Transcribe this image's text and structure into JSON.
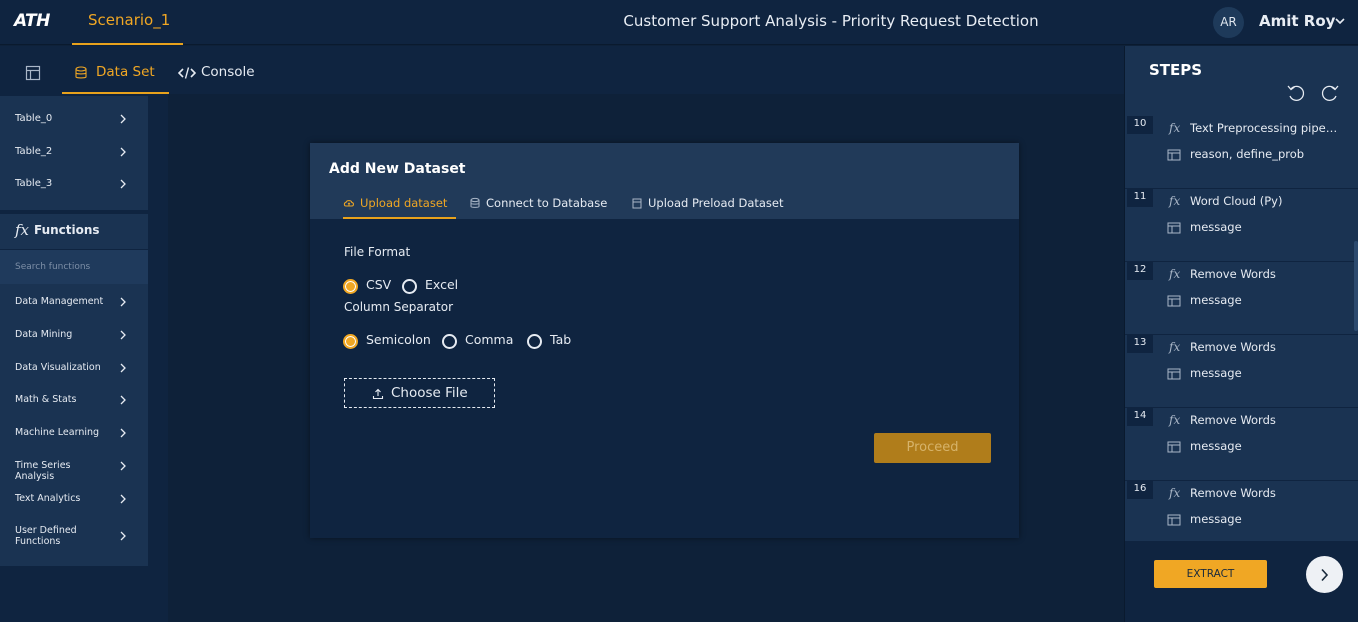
{
  "app": {
    "logo": "ATH",
    "scenario_tab": "Scenario_1",
    "page_title": "Customer Support Analysis - Priority Request Detection",
    "user_initials": "AR",
    "user_name": "Amit Roy"
  },
  "subtabs": {
    "dataset": "Data Set",
    "console": "Console"
  },
  "sidebar": {
    "tables": [
      "Table_0",
      "Table_2",
      "Table_3"
    ],
    "functions_title": "Functions",
    "functions_icon": "fx",
    "search_placeholder": "Search functions",
    "categories": [
      "Data Management",
      "Data Mining",
      "Data Visualization",
      "Math & Stats",
      "Machine Learning",
      "Time Series Analysis",
      "Text Analytics",
      "User Defined Functions"
    ]
  },
  "dialog": {
    "title": "Add New Dataset",
    "tabs": [
      "Upload dataset",
      "Connect to Database",
      "Upload Preload Dataset"
    ],
    "file_format_label": "File Format",
    "file_formats": [
      "CSV",
      "Excel"
    ],
    "file_format_selected": "CSV",
    "separator_label": "Column Separator",
    "separators": [
      "Semicolon",
      "Comma",
      "Tab"
    ],
    "separator_selected": "Semicolon",
    "choose_file": "Choose File",
    "proceed": "Proceed"
  },
  "steps": {
    "title": "STEPS",
    "items": [
      {
        "num": "10",
        "fx": "fx",
        "name": "Text Preprocessing pipeline",
        "column": "reason, define_prob"
      },
      {
        "num": "11",
        "fx": "fx",
        "name": "Word Cloud (Py)",
        "column": "message"
      },
      {
        "num": "12",
        "fx": "fx",
        "name": "Remove Words",
        "column": "message"
      },
      {
        "num": "13",
        "fx": "fx",
        "name": "Remove Words",
        "column": "message"
      },
      {
        "num": "14",
        "fx": "fx",
        "name": "Remove Words",
        "column": "message"
      },
      {
        "num": "16",
        "fx": "fx",
        "name": "Remove Words",
        "column": "message"
      }
    ],
    "extract": "EXTRACT"
  },
  "colors": {
    "accent": "#f0a724",
    "background": "#0e2139",
    "panel": "#1a3352"
  }
}
